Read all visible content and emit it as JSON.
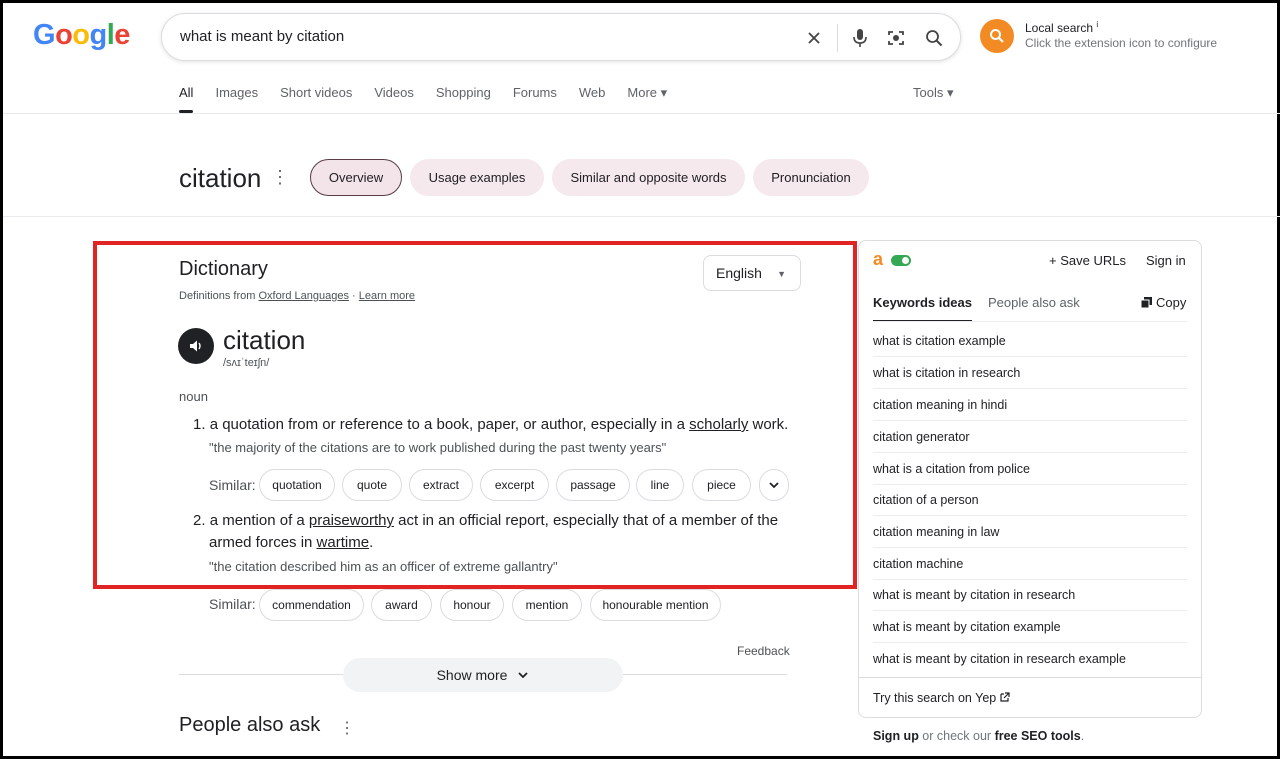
{
  "logo": {
    "letters": [
      "G",
      "o",
      "o",
      "g",
      "l",
      "e"
    ],
    "colors": [
      "#4285f4",
      "#ea4335",
      "#fbbc05",
      "#4285f4",
      "#34a853",
      "#ea4335"
    ]
  },
  "search": {
    "query": "what is meant by citation"
  },
  "extension": {
    "title": "Local search",
    "info": "i",
    "subtitle": "Click the extension icon to configure",
    "color": "#f28b24"
  },
  "tabs": [
    "All",
    "Images",
    "Short videos",
    "Videos",
    "Shopping",
    "Forums",
    "Web",
    "More ▾"
  ],
  "tools": "Tools ▾",
  "topic": {
    "word": "citation",
    "chips": [
      "Overview",
      "Usage examples",
      "Similar and opposite words",
      "Pronunciation"
    ]
  },
  "dictionary": {
    "title": "Dictionary",
    "source_prefix": "Definitions from ",
    "source_link": "Oxford Languages",
    "separator": " · ",
    "learn_more": "Learn more",
    "language": "English",
    "headword": "citation",
    "phonetic": "/sʌɪˈteɪʃn/",
    "pos": "noun",
    "def1": {
      "num": "1.",
      "pre": "a quotation from or reference to a book, paper, or author, especially in a ",
      "link": "scholarly",
      "post": " work.",
      "example": "\"the majority of the citations are to work published during the past twenty years\""
    },
    "similar_label": "Similar:",
    "similar1": [
      "quotation",
      "quote",
      "extract",
      "excerpt",
      "passage",
      "line",
      "piece"
    ],
    "def2": {
      "num": "2.",
      "pre": "a mention of a ",
      "link1": "praiseworthy",
      "mid": " act in an official report, especially that of a member of the",
      "line2_pre": "armed forces in ",
      "link2": "wartime",
      "post": ".",
      "example": "\"the citation described him as an officer of extreme gallantry\""
    },
    "similar2": [
      "commendation",
      "award",
      "honour",
      "mention",
      "honourable mention"
    ],
    "feedback": "Feedback",
    "show_more": "Show more"
  },
  "people_also_ask": "People also ask",
  "panel": {
    "logo": "a",
    "save_urls": "+ Save URLs",
    "sign_in": "Sign in",
    "tab_keywords": "Keywords ideas",
    "tab_paa": "People also ask",
    "copy": "Copy",
    "keywords": [
      "what is citation example",
      "what is citation in research",
      "citation meaning in hindi",
      "citation generator",
      "what is a citation from police",
      "citation of a person",
      "citation meaning in law",
      "citation machine",
      "what is meant by citation in research",
      "what is meant by citation example",
      "what is meant by citation in research example"
    ],
    "try_yep": "Try this search on Yep"
  },
  "footer": {
    "signup": "Sign up",
    "middle": " or check our ",
    "seo": "free SEO tools",
    "end": "."
  }
}
